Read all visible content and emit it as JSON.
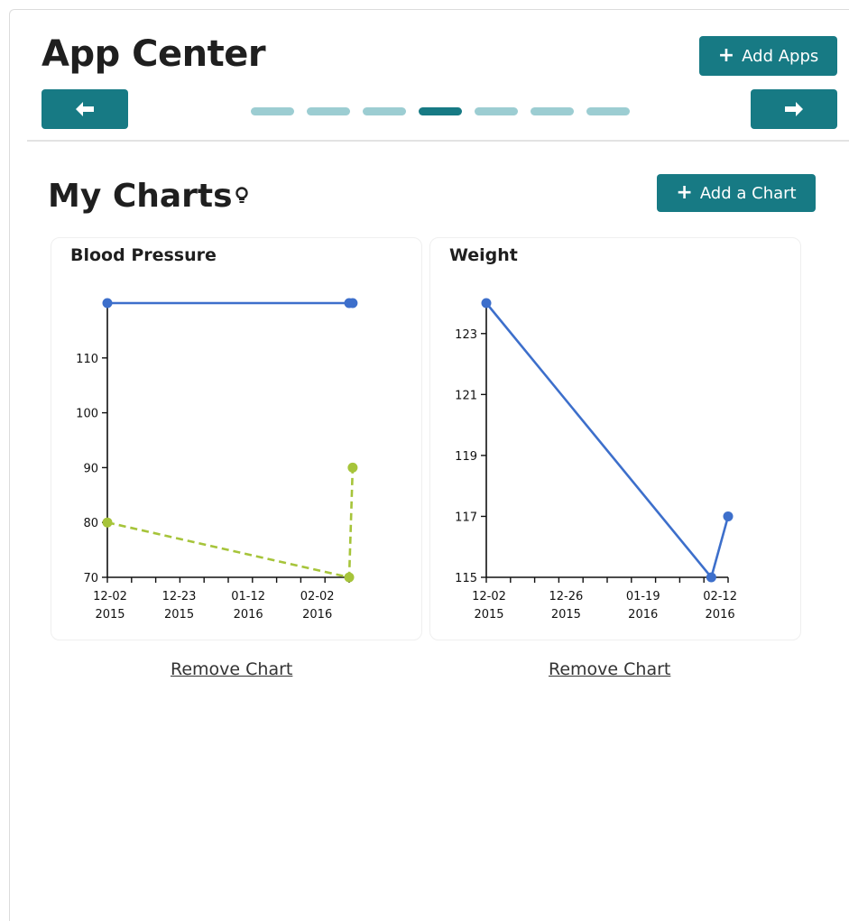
{
  "header": {
    "title": "App Center",
    "add_apps_label": "Add Apps",
    "pager": {
      "count": 7,
      "active_index": 3
    }
  },
  "section": {
    "title": "My Charts",
    "add_chart_label": "Add a Chart"
  },
  "charts": [
    {
      "title": "Blood Pressure",
      "remove_label": "Remove Chart"
    },
    {
      "title": "Weight",
      "remove_label": "Remove Chart"
    }
  ],
  "colors": {
    "accent": "#177a84",
    "pager_inactive": "#9ccdd2",
    "series_blue": "#3d6fcb",
    "series_green": "#a6c43a"
  },
  "chart_data": [
    {
      "type": "line",
      "title": "Blood Pressure",
      "yticks": [
        70,
        80,
        90,
        100,
        110
      ],
      "ylim": [
        70,
        120
      ],
      "xtick_labels": [
        [
          "12-02",
          "2015"
        ],
        [
          "12-23",
          "2015"
        ],
        [
          "01-12",
          "2016"
        ],
        [
          "02-02",
          "2016"
        ]
      ],
      "xlim": [
        "2015-12-02",
        "2016-02-09"
      ],
      "series": [
        {
          "points": [
            [
              "2015-12-02",
              120
            ],
            [
              "2016-02-09",
              120
            ],
            [
              "2016-02-10",
              120
            ]
          ],
          "style": "solid",
          "color": "#3d6fcb"
        },
        {
          "points": [
            [
              "2015-12-02",
              80
            ],
            [
              "2016-02-09",
              70
            ],
            [
              "2016-02-10",
              90
            ]
          ],
          "style": "dashed",
          "color": "#a6c43a"
        }
      ]
    },
    {
      "type": "line",
      "title": "Weight",
      "yticks": [
        115,
        117,
        119,
        121,
        123
      ],
      "ylim": [
        115,
        124
      ],
      "xtick_labels": [
        [
          "12-02",
          "2015"
        ],
        [
          "12-26",
          "2015"
        ],
        [
          "01-19",
          "2016"
        ],
        [
          "02-12",
          "2016"
        ]
      ],
      "xlim": [
        "2015-12-02",
        "2016-02-12"
      ],
      "series": [
        {
          "points": [
            [
              "2015-12-02",
              124
            ],
            [
              "2016-02-07",
              115
            ],
            [
              "2016-02-12",
              117
            ]
          ],
          "style": "solid",
          "color": "#3d6fcb"
        }
      ]
    }
  ]
}
